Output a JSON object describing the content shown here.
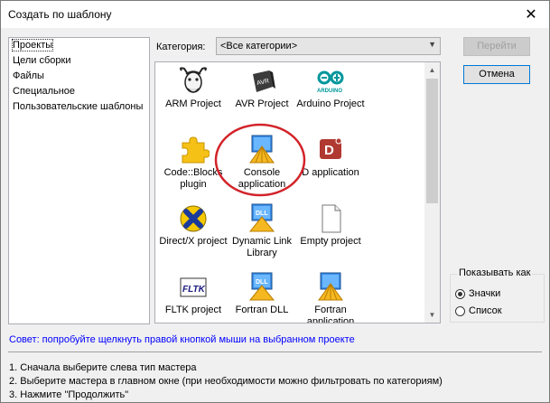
{
  "window": {
    "title": "Создать по шаблону",
    "close_glyph": "✕"
  },
  "sidebar": {
    "items": [
      {
        "label": "Проекты",
        "selected": true
      },
      {
        "label": "Цели сборки"
      },
      {
        "label": "Файлы"
      },
      {
        "label": "Специальное"
      },
      {
        "label": "Пользовательские шаблоны"
      }
    ]
  },
  "category": {
    "label": "Категория:",
    "value": "<Все категории>"
  },
  "templates": [
    {
      "id": "arm",
      "label": "ARM Project",
      "icon": "gnu-icon"
    },
    {
      "id": "avr",
      "label": "AVR Project",
      "icon": "avr-chip-icon"
    },
    {
      "id": "arduino",
      "label": "Arduino Project",
      "icon": "arduino-icon"
    },
    {
      "id": "cbplugin",
      "label": "Code::Blocks plugin",
      "icon": "puzzle-icon"
    },
    {
      "id": "console",
      "label": "Console application",
      "icon": "console-app-icon"
    },
    {
      "id": "d",
      "label": "D application",
      "icon": "d-lang-icon"
    },
    {
      "id": "directx",
      "label": "Direct/X project",
      "icon": "directx-icon"
    },
    {
      "id": "dll",
      "label": "Dynamic Link Library",
      "icon": "dll-icon"
    },
    {
      "id": "empty",
      "label": "Empty project",
      "icon": "empty-file-icon"
    },
    {
      "id": "fltk",
      "label": "FLTK project",
      "icon": "fltk-icon"
    },
    {
      "id": "fortrandll",
      "label": "Fortran DLL",
      "icon": "fortran-dll-icon"
    },
    {
      "id": "fortranapp",
      "label": "Fortran application",
      "icon": "fortran-app-icon"
    }
  ],
  "buttons": {
    "go": "Перейти",
    "cancel": "Отмена"
  },
  "view": {
    "legend": "Показывать как",
    "options": [
      {
        "label": "Значки",
        "selected": true
      },
      {
        "label": "Список",
        "selected": false
      }
    ]
  },
  "tip": "Совет: попробуйте щелкнуть правой кнопкой мыши на выбранном проекте",
  "steps": [
    "1. Сначала выберите слева тип мастера",
    "2. Выберите мастера в главном окне (при необходимости можно фильтровать по категориям)",
    "3. Нажмите \"Продолжить\""
  ],
  "colors": {
    "highlight_circle": "#d2232a",
    "link_blue": "#0000ff"
  }
}
